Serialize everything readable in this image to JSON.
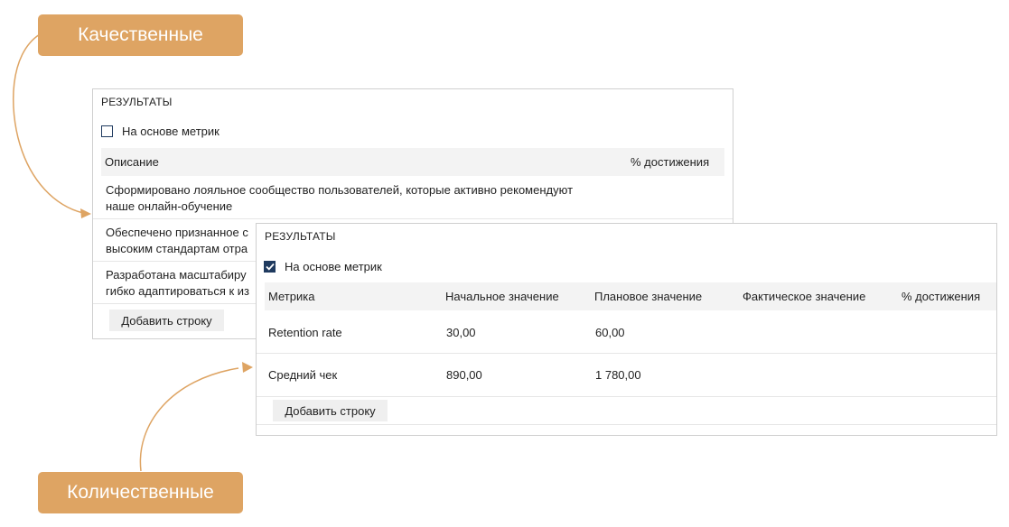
{
  "callouts": {
    "qualitative": "Качественные",
    "quantitative": "Количественные"
  },
  "qualitative_panel": {
    "title": "РЕЗУЛЬТАТЫ",
    "metrics_checkbox": {
      "label": "На основе метрик",
      "checked": false
    },
    "columns": [
      "Описание",
      "% достижения"
    ],
    "rows": [
      {
        "line1": "Сформировано лояльное сообщество пользователей, которые активно рекомендуют",
        "line2": "наше онлайн-обучение"
      },
      {
        "line1": "Обеспечено признанное с",
        "line2": "высоким стандартам отра"
      },
      {
        "line1": "Разработана масштабиру",
        "line2": "гибко адаптироваться к из"
      }
    ],
    "add_row_label": "Добавить строку"
  },
  "quantitative_panel": {
    "title": "РЕЗУЛЬТАТЫ",
    "metrics_checkbox": {
      "label": "На основе метрик",
      "checked": true
    },
    "columns": [
      "Метрика",
      "Начальное значение",
      "Плановое значение",
      "Фактическое значение",
      "% достижения"
    ],
    "rows": [
      {
        "metric": "Retention rate",
        "initial": "30,00",
        "planned": "60,00",
        "actual": "",
        "achievement": ""
      },
      {
        "metric": "Средний чек",
        "initial": "890,00",
        "planned": "1 780,00",
        "actual": "",
        "achievement": ""
      }
    ],
    "add_row_label": "Добавить строку"
  },
  "colors": {
    "accent": "#dea463",
    "checkbox": "#1f3a5f",
    "header_bg": "#f3f3f3"
  }
}
